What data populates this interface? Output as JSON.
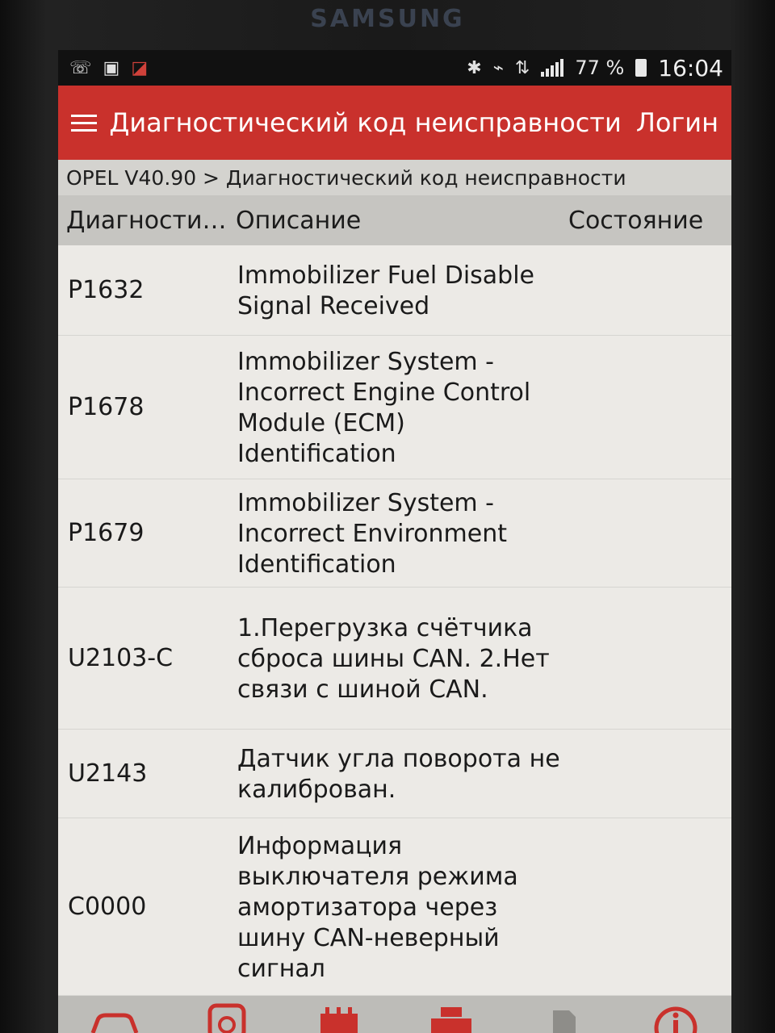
{
  "device": {
    "brand": "SAMSUNG"
  },
  "statusbar": {
    "battery": "77 %",
    "time": "16:04"
  },
  "appbar": {
    "title": "Диагностический код неисправности",
    "login": "Логин"
  },
  "breadcrumb": "OPEL V40.90 > Диагностический код неисправности",
  "table": {
    "headers": {
      "code": "Диагности…",
      "description": "Описание",
      "state": "Состояние"
    },
    "rows": [
      {
        "code": "P1632",
        "description": "Immobilizer Fuel Disable Signal Received",
        "state": ""
      },
      {
        "code": "P1678",
        "description": "Immobilizer System - Incorrect Engine Control Module (ECM) Identification",
        "state": ""
      },
      {
        "code": "P1679",
        "description": "Immobilizer System - Incorrect Environment Identification",
        "state": ""
      },
      {
        "code": "U2103-C",
        "description": "1.Перегрузка счётчика сброса шины CAN. 2.Нет связи с шиной CAN.",
        "state": ""
      },
      {
        "code": "U2143",
        "description": "Датчик угла поворота не калиброван.",
        "state": ""
      },
      {
        "code": "C0000",
        "description": "Информация выключателя режима амортизатора через шину CAN-неверный сигнал",
        "state": ""
      }
    ]
  },
  "colors": {
    "appbar": "#c9312c",
    "toolbar_icon": "#c9312c"
  }
}
